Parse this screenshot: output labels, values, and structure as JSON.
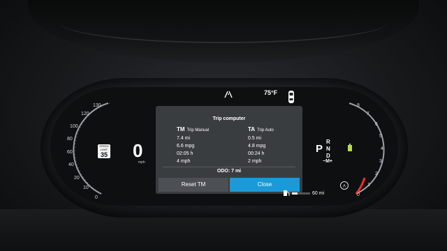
{
  "status": {
    "navigation_icon": "road-icon",
    "temperature": "75°F",
    "car_icon": "car-doors-icon"
  },
  "speedometer": {
    "ticks": [
      "130",
      "120",
      "100",
      "80",
      "60",
      "40",
      "20",
      "10",
      "0"
    ],
    "speed": "0",
    "unit": "mph",
    "speed_limit_label": "SPEED LIMIT",
    "speed_limit_value": "35"
  },
  "tachometer": {
    "ticks": [
      "8",
      "7",
      "6",
      "5",
      "4",
      "3",
      "2",
      "1",
      "0"
    ]
  },
  "gear": {
    "current": "P",
    "options": [
      "R",
      "N",
      "D"
    ],
    "mode": "−M+"
  },
  "trip_computer": {
    "title": "Trip computer",
    "manual": {
      "code": "TM",
      "label": "Trip Manual",
      "distance": "7.4 mi",
      "economy": "6.6 mpg",
      "time": "02:05 h",
      "avg_speed": "4 mph"
    },
    "auto": {
      "code": "TA",
      "label": "Trip Auto",
      "distance": "0.5 mi",
      "economy": "4.8 mpg",
      "time": "00:24 h",
      "avg_speed": "2 mph"
    },
    "odo_label": "ODO:",
    "odo_value": "7 mi",
    "reset_label": "Reset TM",
    "close_label": "Close"
  },
  "fuel": {
    "range": "60 mi",
    "level_fraction": 0.3
  },
  "colors": {
    "accent": "#1a9ad8",
    "popup_bg": "#3a3d40"
  }
}
